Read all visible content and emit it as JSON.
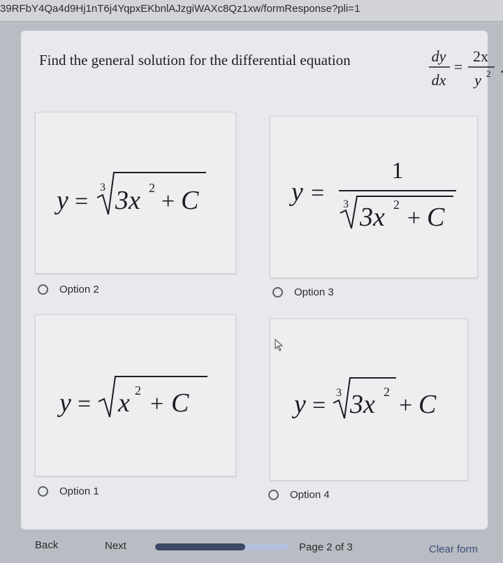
{
  "browser": {
    "url": "39RFbY4Qa4d9Hj1nT6j4YqpxEKbnlAJzgiWAXc8Qz1xw/formResponse?pli=1"
  },
  "question": {
    "text": "Find the general solution for  the  differential equation",
    "equation": {
      "lhs_num": "dy",
      "lhs_den": "dx",
      "eq": "=",
      "rhs_num": "2x",
      "rhs_den": "y",
      "rhs_den_exp": "2",
      "period": "."
    }
  },
  "options": [
    {
      "label": "Option 2",
      "formula": {
        "y": "y",
        "eq": "=",
        "root_index": "3",
        "term": "3x",
        "exp": "2",
        "plus": "+",
        "c": "C"
      }
    },
    {
      "label": "Option 3",
      "formula": {
        "y": "y",
        "eq": "=",
        "num": "1",
        "root_index": "3",
        "term": "3x",
        "exp": "2",
        "plus": "+",
        "c": "C"
      }
    },
    {
      "label": "Option 1",
      "formula": {
        "y": "y",
        "eq": "=",
        "term": "x",
        "exp": "2",
        "plus": "+",
        "c": "C"
      }
    },
    {
      "label": "Option 4",
      "formula": {
        "y": "y",
        "eq": "=",
        "root_index": "3",
        "term": "3x",
        "exp": "2",
        "plus": "+",
        "c": "C"
      }
    }
  ],
  "nav": {
    "back": "Back",
    "next": "Next",
    "progress": 0.67,
    "page": "Page 2 of 3",
    "clear": "Clear form"
  },
  "colors": {
    "progress_fill": "#3c4866",
    "progress_track": "#b4c0de",
    "clear_link": "#3b4a78"
  }
}
